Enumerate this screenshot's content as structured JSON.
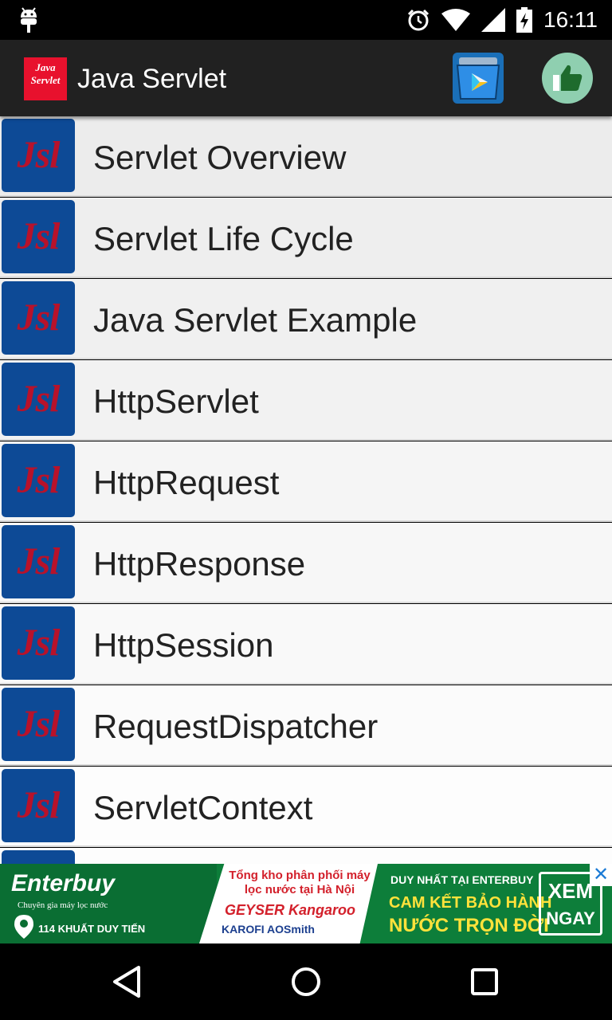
{
  "status_bar": {
    "time": "16:11",
    "icons": [
      "android-debug-icon",
      "alarm-icon",
      "wifi-icon",
      "signal-icon",
      "battery-icon"
    ]
  },
  "app_bar": {
    "logo_line1": "Java",
    "logo_line2": "Servlet",
    "title": "Java Servlet",
    "actions": [
      "play-store-icon",
      "thumbs-up-icon"
    ]
  },
  "list": {
    "icon_text": "Jsl",
    "items": [
      "Servlet Overview",
      "Servlet Life Cycle",
      "Java Servlet Example",
      "HttpServlet",
      "HttpRequest",
      "HttpResponse",
      "HttpSession",
      "RequestDispatcher",
      "ServletContext"
    ]
  },
  "ad": {
    "brand": "Enterbuy",
    "tagline": "Chuyên gia máy lọc nước",
    "address": "114 KHUẤT DUY TIẾN",
    "mid_title": "Tổng kho phân phối máy lọc nước tại Hà Nội",
    "brands_row1": "GEYSER  Kangaroo",
    "brands_row2": "KAROFI  AOSmith",
    "right_line1": "DUY NHẤT TẠI ENTERBUY",
    "right_line2": "CAM KẾT BẢO HÀNH",
    "right_line3": "NƯỚC TRỌN ĐỜI",
    "cta_line1": "XEM",
    "cta_line2": "NGAY",
    "close": "✕"
  },
  "nav_bar": {
    "buttons": [
      "back-icon",
      "home-icon",
      "recents-icon"
    ]
  },
  "colors": {
    "app_bar": "#212121",
    "list_icon_bg": "#0d4a96",
    "list_icon_text": "#b8122a",
    "ad_green": "#0d7e3a"
  }
}
